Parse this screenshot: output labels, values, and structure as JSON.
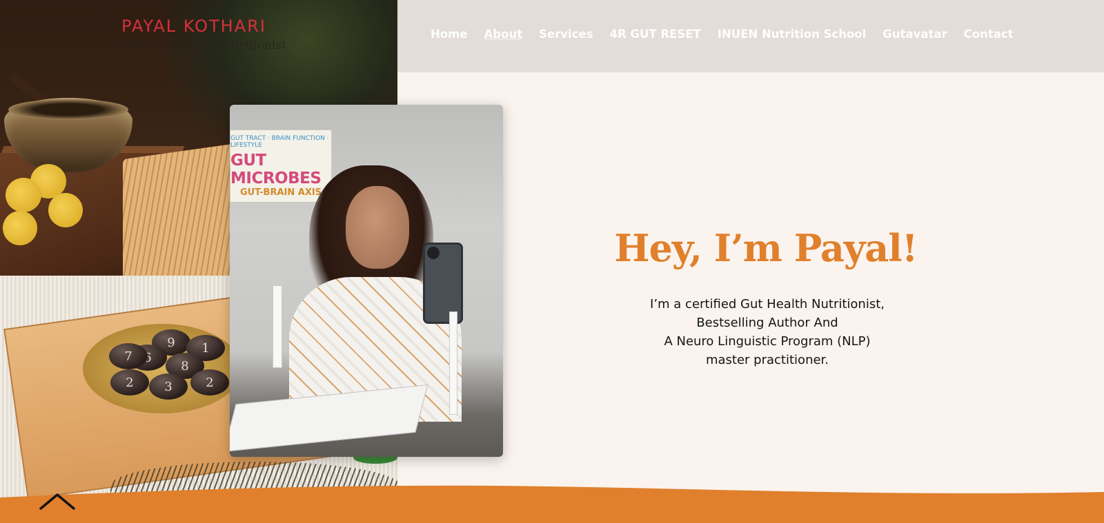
{
  "brand": {
    "name": "PAYAL KOTHARI",
    "tagline": "The Gut Health Nutritionist",
    "name_color": "#d6313b"
  },
  "nav": {
    "items": [
      {
        "label": "Home",
        "active": false
      },
      {
        "label": "About",
        "active": true
      },
      {
        "label": "Services",
        "active": false
      },
      {
        "label": "4R GUT RESET",
        "active": false
      },
      {
        "label": "INUEN Nutrition School",
        "active": false
      },
      {
        "label": "Gutavatar",
        "active": false
      },
      {
        "label": "Contact",
        "active": false
      }
    ]
  },
  "photo": {
    "poster_top": "GUT TRACT · BRAIN FUNCTION · LIFESTYLE",
    "poster_main": "GUT MICROBES",
    "poster_sub": "GUT-BRAIN AXIS"
  },
  "stones": [
    "9",
    "6",
    "1",
    "7",
    "8",
    "2",
    "3",
    "2"
  ],
  "hero": {
    "title": "Hey, I’m Payal!",
    "lines": [
      "I’m a certified Gut Health Nutritionist,",
      "Bestselling Author And",
      "A Neuro Linguistic Program (NLP)",
      "master practitioner."
    ]
  },
  "scroll_top": {
    "icon": "chevron-up-icon"
  },
  "colors": {
    "accent": "#e0802c",
    "wave": "#e0802c",
    "header_bg": "#e4dcd8",
    "page_bg": "#fbf3ee"
  }
}
